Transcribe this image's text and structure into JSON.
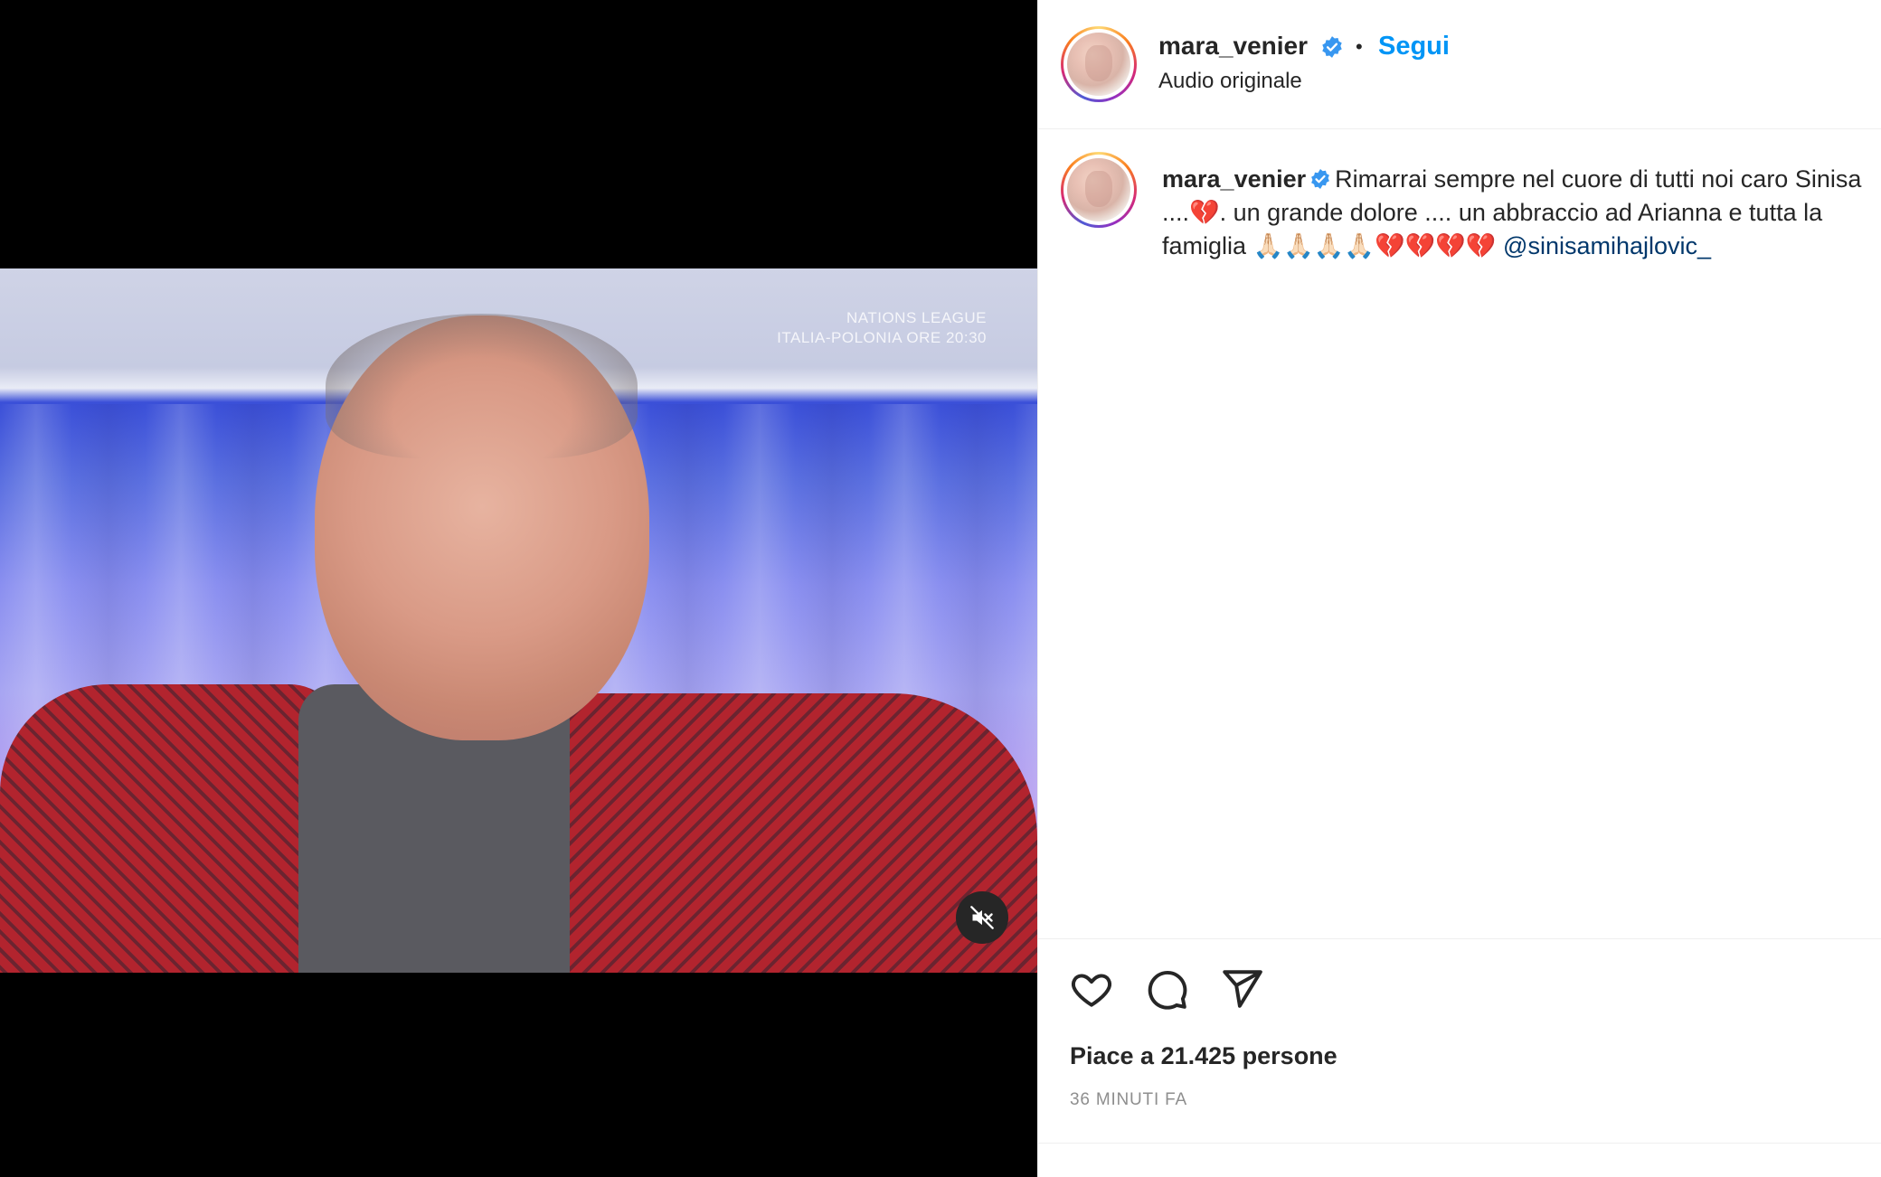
{
  "post": {
    "username": "mara_venier",
    "follow_label": "Segui",
    "separator": "•",
    "audio_label": "Audio originale",
    "video_overlay_line1": "NATIONS LEAGUE",
    "video_overlay_line2": "ITALIA-POLONIA ORE 20:30",
    "caption": {
      "username": "mara_venier",
      "text": "Rimarrai sempre nel cuore di tutti noi caro Sinisa ....",
      "text2": ". un grande dolore .... un abbraccio ad Arianna e tutta la famiglia ",
      "mention": "@sinisamihajlovic_"
    },
    "likes_text": "Piace a 21.425 persone",
    "time_text": "36 MINUTI FA"
  },
  "icons": {
    "verified": "verified-badge-icon",
    "like": "heart-icon",
    "comment": "comment-icon",
    "share": "share-icon",
    "mute": "muted-speaker-icon"
  },
  "colors": {
    "accent": "#0095f6",
    "mention": "#00376b",
    "verified": "#3897f0",
    "muted_text": "#8e8e8e"
  }
}
